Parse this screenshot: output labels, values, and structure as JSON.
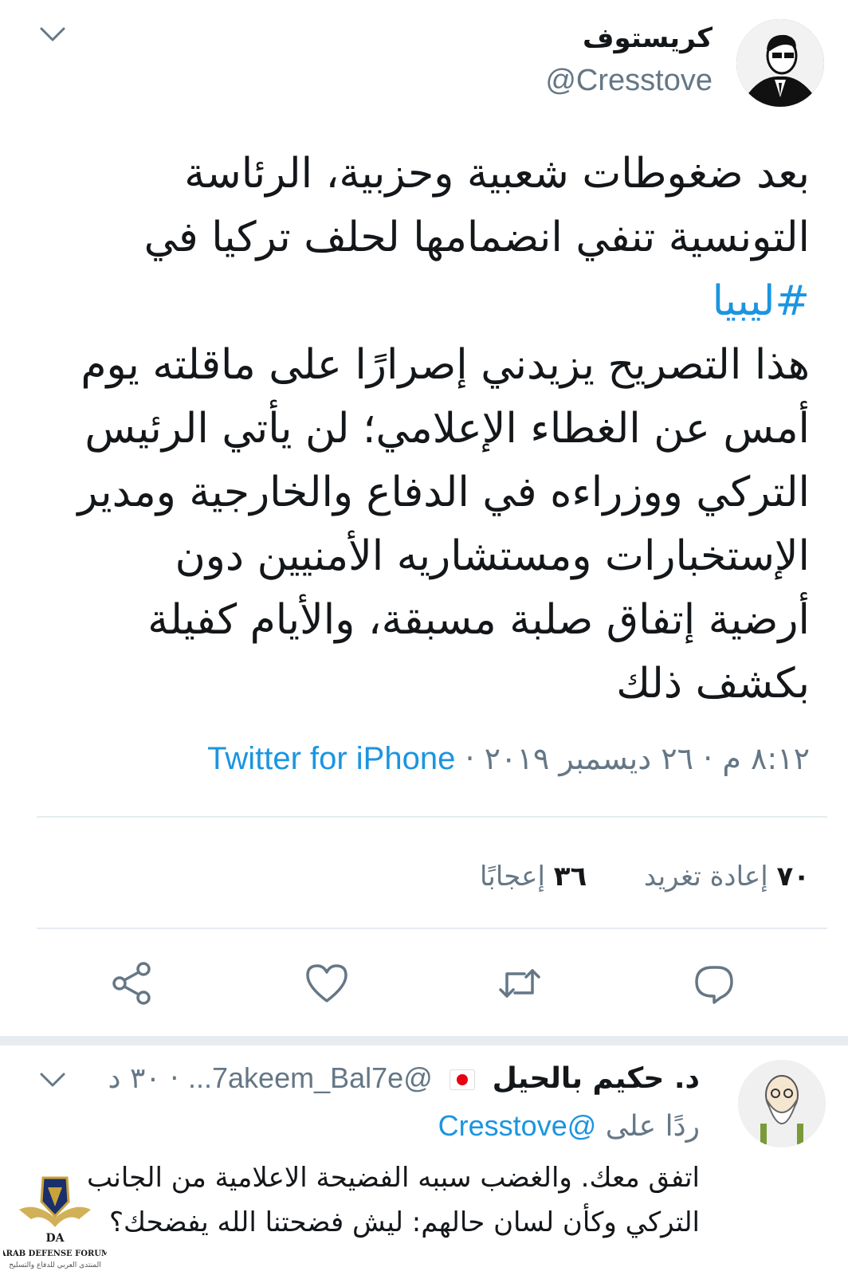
{
  "tweet": {
    "author_name": "كريستوف",
    "author_handle": "@Cresstove",
    "body_lines": [
      "بعد ضغوطات شعبية وحزبية، الرئاسة",
      "التونسية تنفي انضمامها لحلف تركيا في",
      "#ليبيا",
      "هذا التصريح يزيدني إصرارًا على ماقلته يوم",
      "أمس عن الغطاء الإعلامي؛ لن يأتي الرئيس",
      "التركي ووزراءه في الدفاع والخارجية ومدير",
      "الإستخبارات ومستشاريه الأمنيين دون",
      "أرضية إتفاق صلبة مسبقة، والأيام كفيلة",
      "بكشف ذلك"
    ],
    "time": "٨:١٢ م",
    "separator": "·",
    "date": "٢٦ ديسمبر ٢٠١٩",
    "source": "Twitter for iPhone",
    "retweets_count": "٧٠",
    "retweets_label": "إعادة تغريد",
    "likes_count": "٣٦",
    "likes_label": "إعجابًا"
  },
  "actions": {
    "icons": [
      "reply-icon",
      "retweet-icon",
      "like-icon",
      "share-icon"
    ]
  },
  "reply": {
    "author_name": "د. حكيم بالحيل",
    "author_handle": "@7akeem_Bal7e...",
    "separator": "·",
    "time": "٣٠ د",
    "replying_prefix": "ردًا على",
    "replying_to": "@Cresstove",
    "text_lines": [
      "اتفق معك. والغضب سببه الفضيحة الاعلامية من الجانب",
      "التركي وكأن لسان حالهم: ليش فضحتنا الله يفضحك؟"
    ]
  },
  "watermark": {
    "text": "ARAB DEFENSE FORUM",
    "subtext": "المنتدى العربي للدفاع والتسليح",
    "logo_letters": "DA"
  },
  "colors": {
    "link": "#1b95e0",
    "secondary": "#657786",
    "divider": "#e6ecf0",
    "icon": "#657786"
  }
}
